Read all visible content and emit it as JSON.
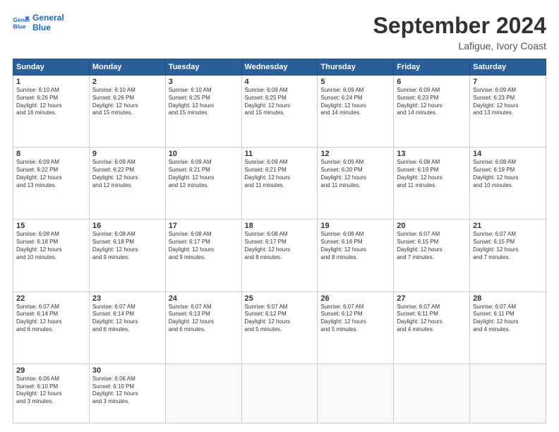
{
  "logo": {
    "line1": "General",
    "line2": "Blue"
  },
  "header": {
    "month": "September 2024",
    "location": "Lafigue, Ivory Coast"
  },
  "weekdays": [
    "Sunday",
    "Monday",
    "Tuesday",
    "Wednesday",
    "Thursday",
    "Friday",
    "Saturday"
  ],
  "weeks": [
    [
      {
        "day": "1",
        "info": "Sunrise: 6:10 AM\nSunset: 6:26 PM\nDaylight: 12 hours\nand 16 minutes."
      },
      {
        "day": "2",
        "info": "Sunrise: 6:10 AM\nSunset: 6:26 PM\nDaylight: 12 hours\nand 15 minutes."
      },
      {
        "day": "3",
        "info": "Sunrise: 6:10 AM\nSunset: 6:25 PM\nDaylight: 12 hours\nand 15 minutes."
      },
      {
        "day": "4",
        "info": "Sunrise: 6:09 AM\nSunset: 6:25 PM\nDaylight: 12 hours\nand 15 minutes."
      },
      {
        "day": "5",
        "info": "Sunrise: 6:09 AM\nSunset: 6:24 PM\nDaylight: 12 hours\nand 14 minutes."
      },
      {
        "day": "6",
        "info": "Sunrise: 6:09 AM\nSunset: 6:23 PM\nDaylight: 12 hours\nand 14 minutes."
      },
      {
        "day": "7",
        "info": "Sunrise: 6:09 AM\nSunset: 6:23 PM\nDaylight: 12 hours\nand 13 minutes."
      }
    ],
    [
      {
        "day": "8",
        "info": "Sunrise: 6:09 AM\nSunset: 6:22 PM\nDaylight: 12 hours\nand 13 minutes."
      },
      {
        "day": "9",
        "info": "Sunrise: 6:09 AM\nSunset: 6:22 PM\nDaylight: 12 hours\nand 12 minutes."
      },
      {
        "day": "10",
        "info": "Sunrise: 6:09 AM\nSunset: 6:21 PM\nDaylight: 12 hours\nand 12 minutes."
      },
      {
        "day": "11",
        "info": "Sunrise: 6:09 AM\nSunset: 6:21 PM\nDaylight: 12 hours\nand 11 minutes."
      },
      {
        "day": "12",
        "info": "Sunrise: 6:09 AM\nSunset: 6:20 PM\nDaylight: 12 hours\nand 11 minutes."
      },
      {
        "day": "13",
        "info": "Sunrise: 6:08 AM\nSunset: 6:19 PM\nDaylight: 12 hours\nand 11 minutes."
      },
      {
        "day": "14",
        "info": "Sunrise: 6:08 AM\nSunset: 6:19 PM\nDaylight: 12 hours\nand 10 minutes."
      }
    ],
    [
      {
        "day": "15",
        "info": "Sunrise: 6:08 AM\nSunset: 6:18 PM\nDaylight: 12 hours\nand 10 minutes."
      },
      {
        "day": "16",
        "info": "Sunrise: 6:08 AM\nSunset: 6:18 PM\nDaylight: 12 hours\nand 9 minutes."
      },
      {
        "day": "17",
        "info": "Sunrise: 6:08 AM\nSunset: 6:17 PM\nDaylight: 12 hours\nand 9 minutes."
      },
      {
        "day": "18",
        "info": "Sunrise: 6:08 AM\nSunset: 6:17 PM\nDaylight: 12 hours\nand 8 minutes."
      },
      {
        "day": "19",
        "info": "Sunrise: 6:08 AM\nSunset: 6:16 PM\nDaylight: 12 hours\nand 8 minutes."
      },
      {
        "day": "20",
        "info": "Sunrise: 6:07 AM\nSunset: 6:15 PM\nDaylight: 12 hours\nand 7 minutes."
      },
      {
        "day": "21",
        "info": "Sunrise: 6:07 AM\nSunset: 6:15 PM\nDaylight: 12 hours\nand 7 minutes."
      }
    ],
    [
      {
        "day": "22",
        "info": "Sunrise: 6:07 AM\nSunset: 6:14 PM\nDaylight: 12 hours\nand 6 minutes."
      },
      {
        "day": "23",
        "info": "Sunrise: 6:07 AM\nSunset: 6:14 PM\nDaylight: 12 hours\nand 6 minutes."
      },
      {
        "day": "24",
        "info": "Sunrise: 6:07 AM\nSunset: 6:13 PM\nDaylight: 12 hours\nand 6 minutes."
      },
      {
        "day": "25",
        "info": "Sunrise: 6:07 AM\nSunset: 6:12 PM\nDaylight: 12 hours\nand 5 minutes."
      },
      {
        "day": "26",
        "info": "Sunrise: 6:07 AM\nSunset: 6:12 PM\nDaylight: 12 hours\nand 5 minutes."
      },
      {
        "day": "27",
        "info": "Sunrise: 6:07 AM\nSunset: 6:11 PM\nDaylight: 12 hours\nand 4 minutes."
      },
      {
        "day": "28",
        "info": "Sunrise: 6:07 AM\nSunset: 6:11 PM\nDaylight: 12 hours\nand 4 minutes."
      }
    ],
    [
      {
        "day": "29",
        "info": "Sunrise: 6:06 AM\nSunset: 6:10 PM\nDaylight: 12 hours\nand 3 minutes."
      },
      {
        "day": "30",
        "info": "Sunrise: 6:06 AM\nSunset: 6:10 PM\nDaylight: 12 hours\nand 3 minutes."
      },
      {
        "day": "",
        "info": ""
      },
      {
        "day": "",
        "info": ""
      },
      {
        "day": "",
        "info": ""
      },
      {
        "day": "",
        "info": ""
      },
      {
        "day": "",
        "info": ""
      }
    ]
  ]
}
